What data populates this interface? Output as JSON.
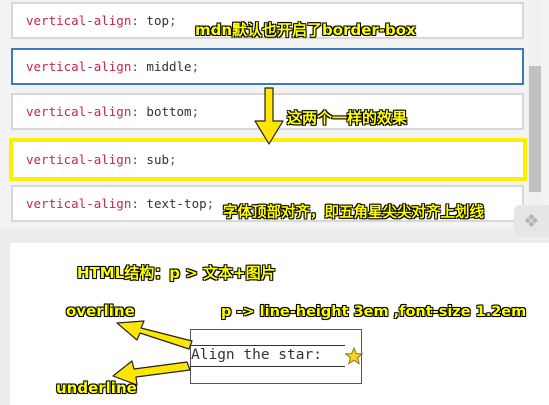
{
  "options": [
    {
      "prop": "vertical-align",
      "value": "top",
      "state": "normal"
    },
    {
      "prop": "vertical-align",
      "value": "middle",
      "state": "selected"
    },
    {
      "prop": "vertical-align",
      "value": "bottom",
      "state": "normal"
    },
    {
      "prop": "vertical-align",
      "value": "sub",
      "state": "highlighted"
    },
    {
      "prop": "vertical-align",
      "value": "text-top",
      "state": "normal"
    }
  ],
  "demo": {
    "text": "Align the star:",
    "icon": "star-icon"
  },
  "annotations": {
    "border_box": "mdn默认也开启了border-box",
    "same_effect": "这两个一样的效果",
    "text_top": "字体顶部对齐，即五角星尖尖对齐上划线",
    "structure": "HTML结构：p > 文本+图片",
    "line_height": "p -> line-height 3em ,font-size 1.2em",
    "overline": "overline",
    "underline": "underline"
  },
  "icons": {
    "side_handle": "expand-icon"
  },
  "colors": {
    "annotation": "#ffff00",
    "highlight_border": "#ffee00",
    "selected_border": "#3c78c3",
    "property": "#c7254e",
    "star": "#f5d327"
  }
}
